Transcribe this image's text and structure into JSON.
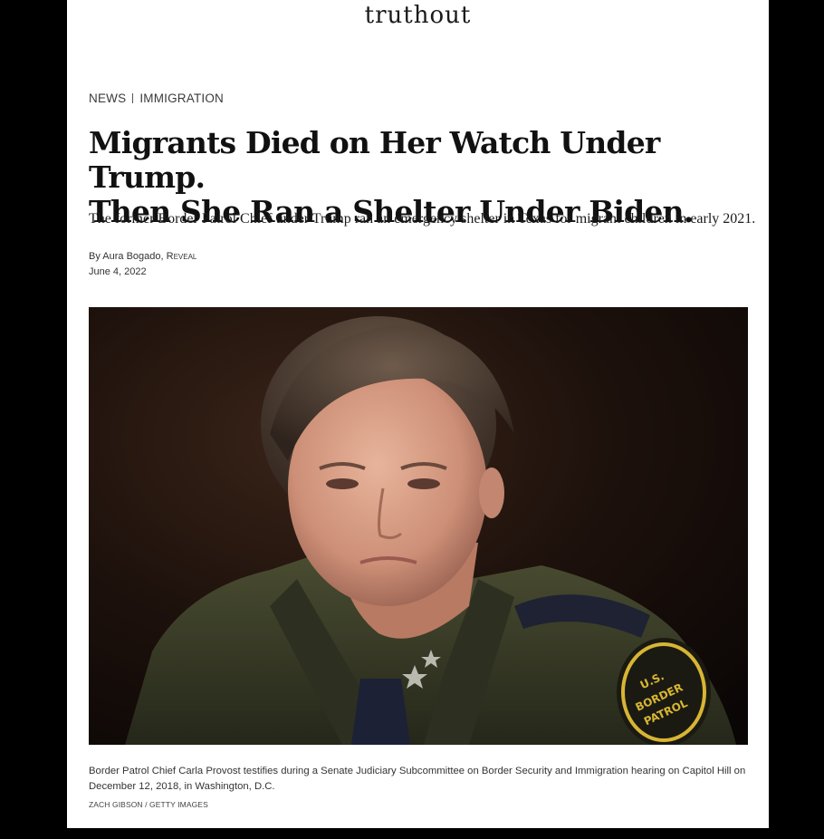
{
  "site": {
    "logo_text": "truthout"
  },
  "breadcrumb": {
    "section": "NEWS",
    "topic": "IMMIGRATION"
  },
  "article": {
    "headline_line1": "Migrants Died on Her Watch Under Trump.",
    "headline_line2": "Then She Ran a Shelter Under Biden.",
    "dek": "The former Border Patrol Chief under Trump ran an emergency shelter in Texas for migrant children in early 2021.",
    "byline_prefix": "By",
    "author": "Aura Bogado",
    "byline_separator": ",",
    "organization": "Reveal",
    "date": "June 4, 2022"
  },
  "image": {
    "caption": "Border Patrol Chief Carla Provost testifies during a Senate Judiciary Subcommittee on Border Security and Immigration hearing on Capitol Hill on December 12, 2018, in Washington, D.C.",
    "credit": "Zach Gibson / Getty Images",
    "patch_text_top": "U.S.",
    "patch_text_mid": "BORDER",
    "patch_text_bot": "PATROL"
  },
  "colors": {
    "background": "#000000",
    "page": "#ffffff",
    "text": "#111111",
    "uniform": "#3a3d26",
    "patch": "#d8b533"
  }
}
